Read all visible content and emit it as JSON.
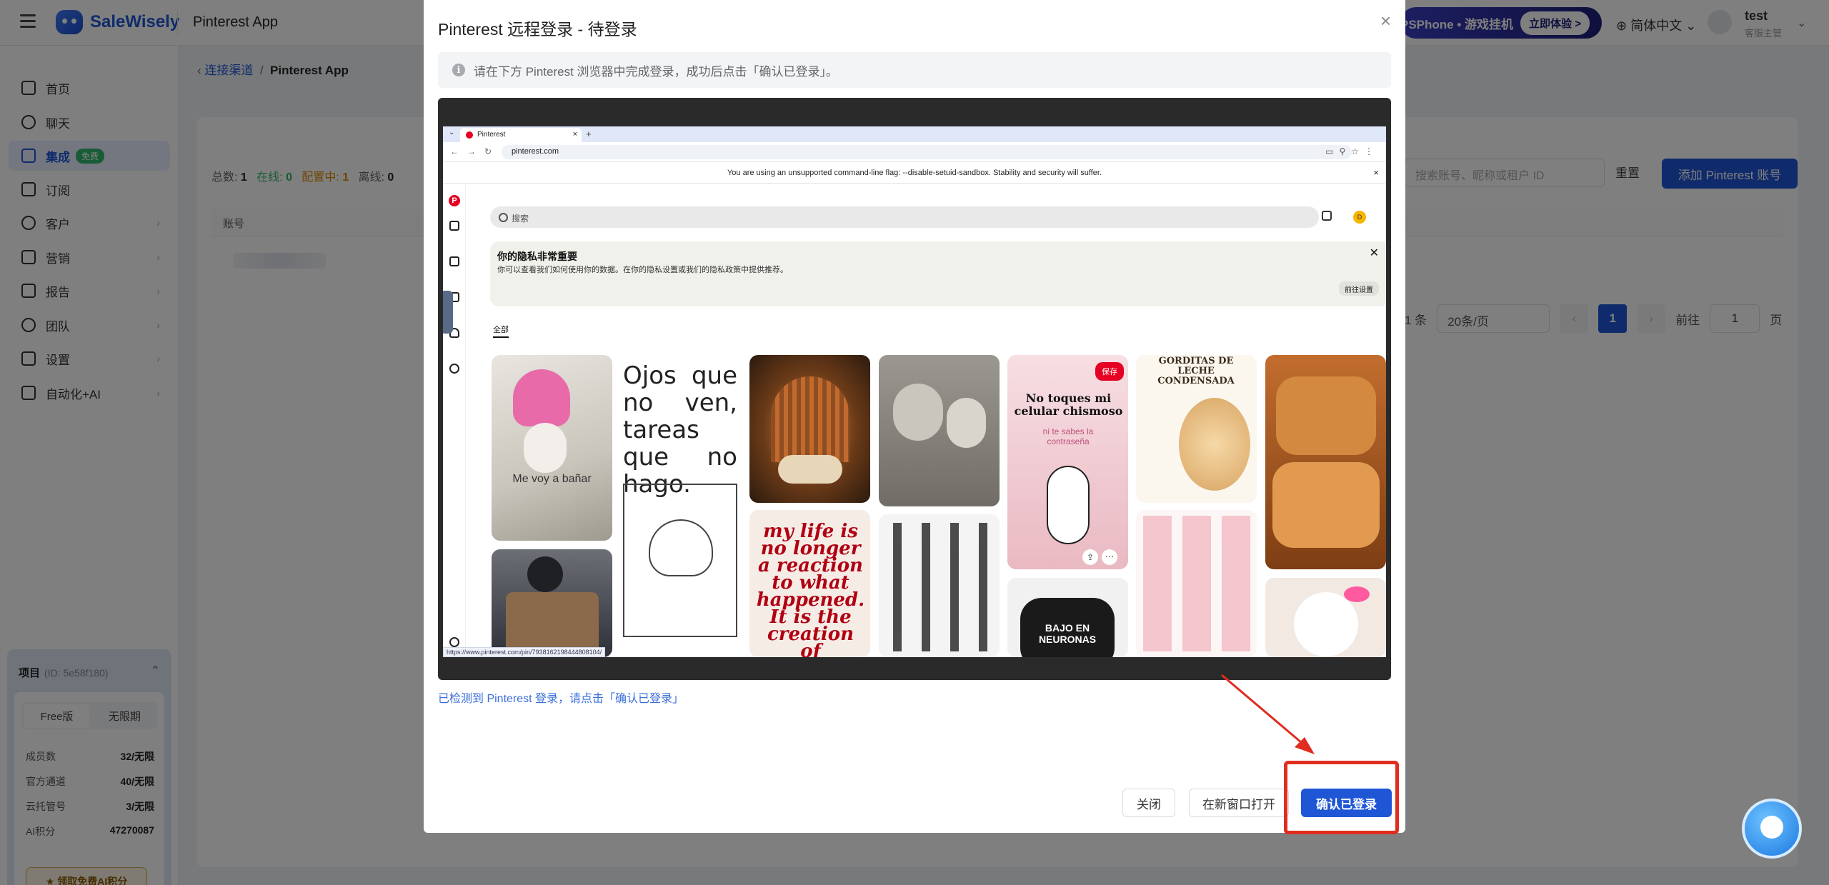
{
  "app": {
    "brand": "SaleWisely",
    "title": "Pinterest App"
  },
  "topbar": {
    "promo_text": "PSPhone • 游戏挂机",
    "promo_cta": "立即体验 >",
    "language": "简体中文",
    "user_name": "test",
    "user_role": "客服主管"
  },
  "sidebar": {
    "items": [
      {
        "label": "首页"
      },
      {
        "label": "聊天"
      },
      {
        "label": "集成",
        "badge": "免费"
      },
      {
        "label": "订阅"
      },
      {
        "label": "客户"
      },
      {
        "label": "营销"
      },
      {
        "label": "报告"
      },
      {
        "label": "团队"
      },
      {
        "label": "设置"
      },
      {
        "label": "自动化+AI"
      }
    ]
  },
  "project": {
    "title": "项目",
    "id": "(ID: 5e58f180)",
    "plan_tabs": [
      "Free版",
      "无限期"
    ],
    "stats": [
      {
        "label": "成员数",
        "value": "32/无限"
      },
      {
        "label": "官方通道",
        "value": "40/无限"
      },
      {
        "label": "云托管号",
        "value": "3/无限"
      },
      {
        "label": "AI积分",
        "value": "47270087"
      }
    ],
    "claim_button": "领取免费AI积分"
  },
  "main": {
    "breadcrumb_parent": "连接渠道",
    "breadcrumb_current": "Pinterest App",
    "counts": {
      "total_label": "总数:",
      "total": "1",
      "online_label": "在线:",
      "online": "0",
      "config_label": "配置中:",
      "config": "1",
      "offline_label": "离线:",
      "offline": "0"
    },
    "search_placeholder": "搜索账号、昵称或租户 ID",
    "reset": "重置",
    "add_button": "添加 Pinterest 账号",
    "column_account": "账号",
    "pager": {
      "total": "1 条",
      "page_size": "20条/页",
      "current": "1",
      "goto_label": "前往",
      "goto_value": "1",
      "page_suffix": "页"
    }
  },
  "modal": {
    "title": "Pinterest 远程登录 - 待登录",
    "info": "请在下方 Pinterest 浏览器中完成登录，成功后点击「确认已登录」。",
    "detected": "已检测到 Pinterest 登录，请点击「确认已登录」",
    "close_button": "关闭",
    "new_window_button": "在新窗口打开",
    "confirm_button": "确认已登录",
    "browser": {
      "tab_title": "Pinterest",
      "url": "pinterest.com",
      "warning": "You are using an unsupported command-line flag: --disable-setuid-sandbox. Stability and security will suffer.",
      "search_placeholder": "搜索",
      "avatar_initial": "D",
      "privacy_title": "你的隐私非常重要",
      "privacy_text": "你可以查看我们如何使用你的数据。在你的隐私设置或我们的隐私政策中提供推荐。",
      "privacy_button": "前往设置",
      "tab_all": "全部",
      "save_label": "保存",
      "status_url": "https://www.pinterest.com/pin/7938162198444808104/",
      "pins": {
        "dog_caption": "Me voy a bañar",
        "ojos": "Ojos que no ven, tareas que no hago.",
        "snoopy_title": "No toques mi celular chismoso",
        "snoopy_sub": "ni te sabes la contraseña",
        "gorditas": "GORDITAS DE LECHE CONDENSADA",
        "mylife": "my life is no longer a reaction to what happened. It is the creation of",
        "neuronas": "BAJO EN NEURONAS"
      }
    }
  },
  "colors": {
    "primary": "#1f56d6",
    "highlight": "#e02d1f",
    "pinterest_red": "#e60023"
  }
}
